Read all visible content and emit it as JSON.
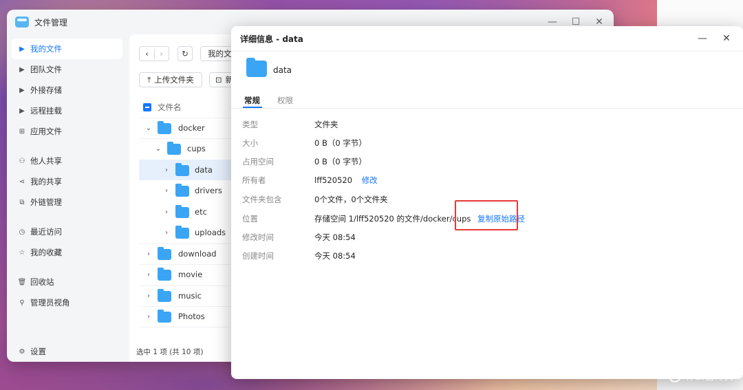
{
  "app": {
    "title": "文件管理"
  },
  "window_controls": {
    "minimize": "—",
    "maximize": "☐",
    "close": "✕"
  },
  "sidebar": {
    "items": [
      {
        "label": "我的文件",
        "icon": "caret-right-icon",
        "active": true
      },
      {
        "label": "团队文件",
        "icon": "caret-right-icon"
      },
      {
        "label": "外接存储",
        "icon": "caret-right-icon"
      },
      {
        "label": "远程挂载",
        "icon": "caret-right-icon"
      },
      {
        "label": "应用文件",
        "icon": "apps-icon"
      },
      {
        "label": "他人共享",
        "icon": "user-share-icon"
      },
      {
        "label": "我的共享",
        "icon": "share-icon"
      },
      {
        "label": "外链管理",
        "icon": "link-icon"
      },
      {
        "label": "最近访问",
        "icon": "clock-icon"
      },
      {
        "label": "我的收藏",
        "icon": "star-icon"
      },
      {
        "label": "回收站",
        "icon": "trash-icon"
      },
      {
        "label": "管理员视角",
        "icon": "admin-icon"
      }
    ],
    "settings_label": "设置"
  },
  "toolbar": {
    "back": "‹",
    "forward": "›",
    "refresh": "↻",
    "breadcrumb": "我的文",
    "upload_folder": "上传文件夹",
    "new_partial": "新"
  },
  "file_list": {
    "column_header": "文件名",
    "rows": [
      {
        "name": "docker",
        "expanded": true,
        "level": 0
      },
      {
        "name": "cups",
        "expanded": true,
        "level": 1
      },
      {
        "name": "data",
        "expanded": false,
        "level": 2,
        "selected": true
      },
      {
        "name": "drivers",
        "expanded": false,
        "level": 2
      },
      {
        "name": "etc",
        "expanded": false,
        "level": 2
      },
      {
        "name": "uploads",
        "expanded": false,
        "level": 2
      },
      {
        "name": "download",
        "expanded": false,
        "level": 0
      },
      {
        "name": "movie",
        "expanded": false,
        "level": 0
      },
      {
        "name": "music",
        "expanded": false,
        "level": 0
      },
      {
        "name": "Photos",
        "expanded": false,
        "level": 0
      }
    ],
    "status": "选中 1 项 (共 10 项)"
  },
  "dialog": {
    "title": "详细信息 - data",
    "name": "data",
    "tabs": [
      "常规",
      "权限"
    ],
    "props": [
      {
        "label": "类型",
        "value": "文件夹"
      },
      {
        "label": "大小",
        "value": "0 B（0 字节）"
      },
      {
        "label": "占用空间",
        "value": "0 B（0 字节）"
      },
      {
        "label": "所有者",
        "value": "lff520520",
        "action": "修改"
      },
      {
        "label": "文件夹包含",
        "value": "0个文件，0个文件夹"
      },
      {
        "label": "位置",
        "value": "存储空间 1/lff520520 的文件/docker/cups",
        "action": "复制原始路径"
      },
      {
        "label": "修改时间",
        "value": "今天 08:54"
      },
      {
        "label": "创建时间",
        "value": "今天 08:54"
      }
    ],
    "controls": {
      "minimize": "—",
      "close": "✕"
    }
  },
  "watermark": {
    "badge": "值",
    "text": "什么值得买"
  },
  "colors": {
    "accent": "#1677ff",
    "folder": "#3aa5f5",
    "highlight": "#e53935"
  }
}
